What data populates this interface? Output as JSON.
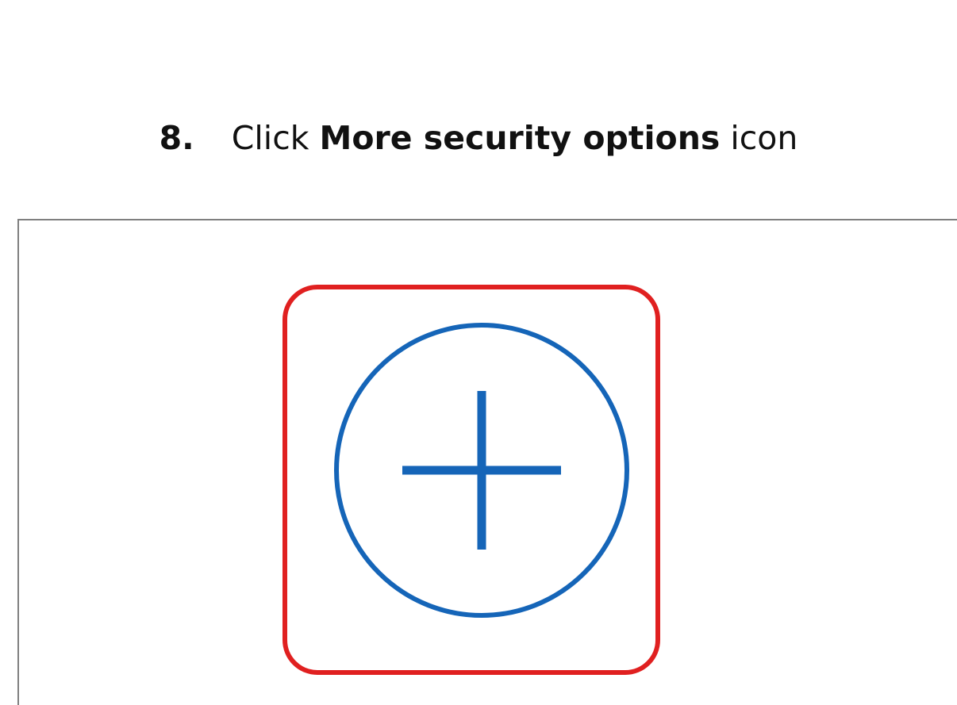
{
  "instruction": {
    "step_number": "8.",
    "prefix": "Click",
    "bold_target": "More security options",
    "suffix": "icon"
  },
  "icon": {
    "name": "add-circle-icon",
    "color": "#1565b8"
  },
  "highlight": {
    "color": "#e02020"
  }
}
